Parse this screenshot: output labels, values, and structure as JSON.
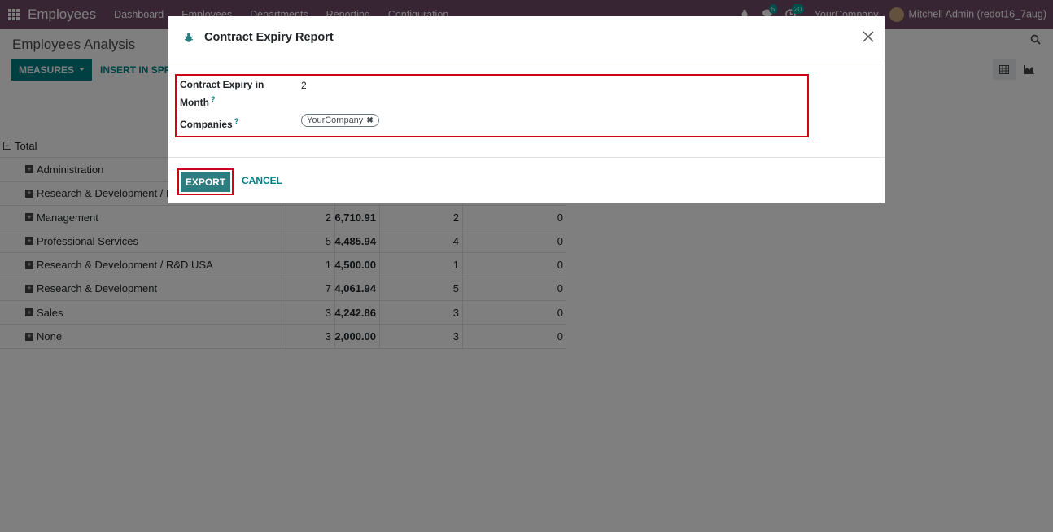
{
  "navbar": {
    "app_name": "Employees",
    "menu": [
      "Dashboard",
      "Employees",
      "Departments",
      "Reporting",
      "Configuration"
    ],
    "messages_count": "5",
    "activities_count": "20",
    "company": "YourCompany",
    "user": "Mitchell Admin (redot16_7aug)"
  },
  "control_panel": {
    "title": "Employees Analysis",
    "measures_label": "MEASURES",
    "insert_label": "INSERT IN SPREA"
  },
  "pivot": {
    "total_label": "Total",
    "rows": [
      {
        "label": "Administration",
        "c1": "",
        "c2": "",
        "c3": "",
        "c4": ""
      },
      {
        "label": "Research & Development / R&D",
        "c1": "",
        "c2": "",
        "c3": "",
        "c4": ""
      },
      {
        "label": "Management",
        "c1": "2",
        "c2": "6,710.91",
        "c3": "2",
        "c4": "0"
      },
      {
        "label": "Professional Services",
        "c1": "5",
        "c2": "4,485.94",
        "c3": "4",
        "c4": "0"
      },
      {
        "label": "Research & Development / R&D USA",
        "c1": "1",
        "c2": "4,500.00",
        "c3": "1",
        "c4": "0"
      },
      {
        "label": "Research & Development",
        "c1": "7",
        "c2": "4,061.94",
        "c3": "5",
        "c4": "0"
      },
      {
        "label": "Sales",
        "c1": "3",
        "c2": "4,242.86",
        "c3": "3",
        "c4": "0"
      },
      {
        "label": "None",
        "c1": "3",
        "c2": "2,000.00",
        "c3": "3",
        "c4": "0"
      }
    ]
  },
  "modal": {
    "title": "Contract Expiry Report",
    "field_expiry_label_line1": "Contract Expiry in",
    "field_expiry_label_line2": "Month",
    "field_expiry_value": "2",
    "field_companies_label": "Companies",
    "company_tag": "YourCompany",
    "help_mark": "?",
    "export_label": "EXPORT",
    "cancel_label": "CANCEL"
  },
  "colors": {
    "navbar": "#714b67",
    "primary": "#017e84",
    "highlight": "#d0021b"
  }
}
